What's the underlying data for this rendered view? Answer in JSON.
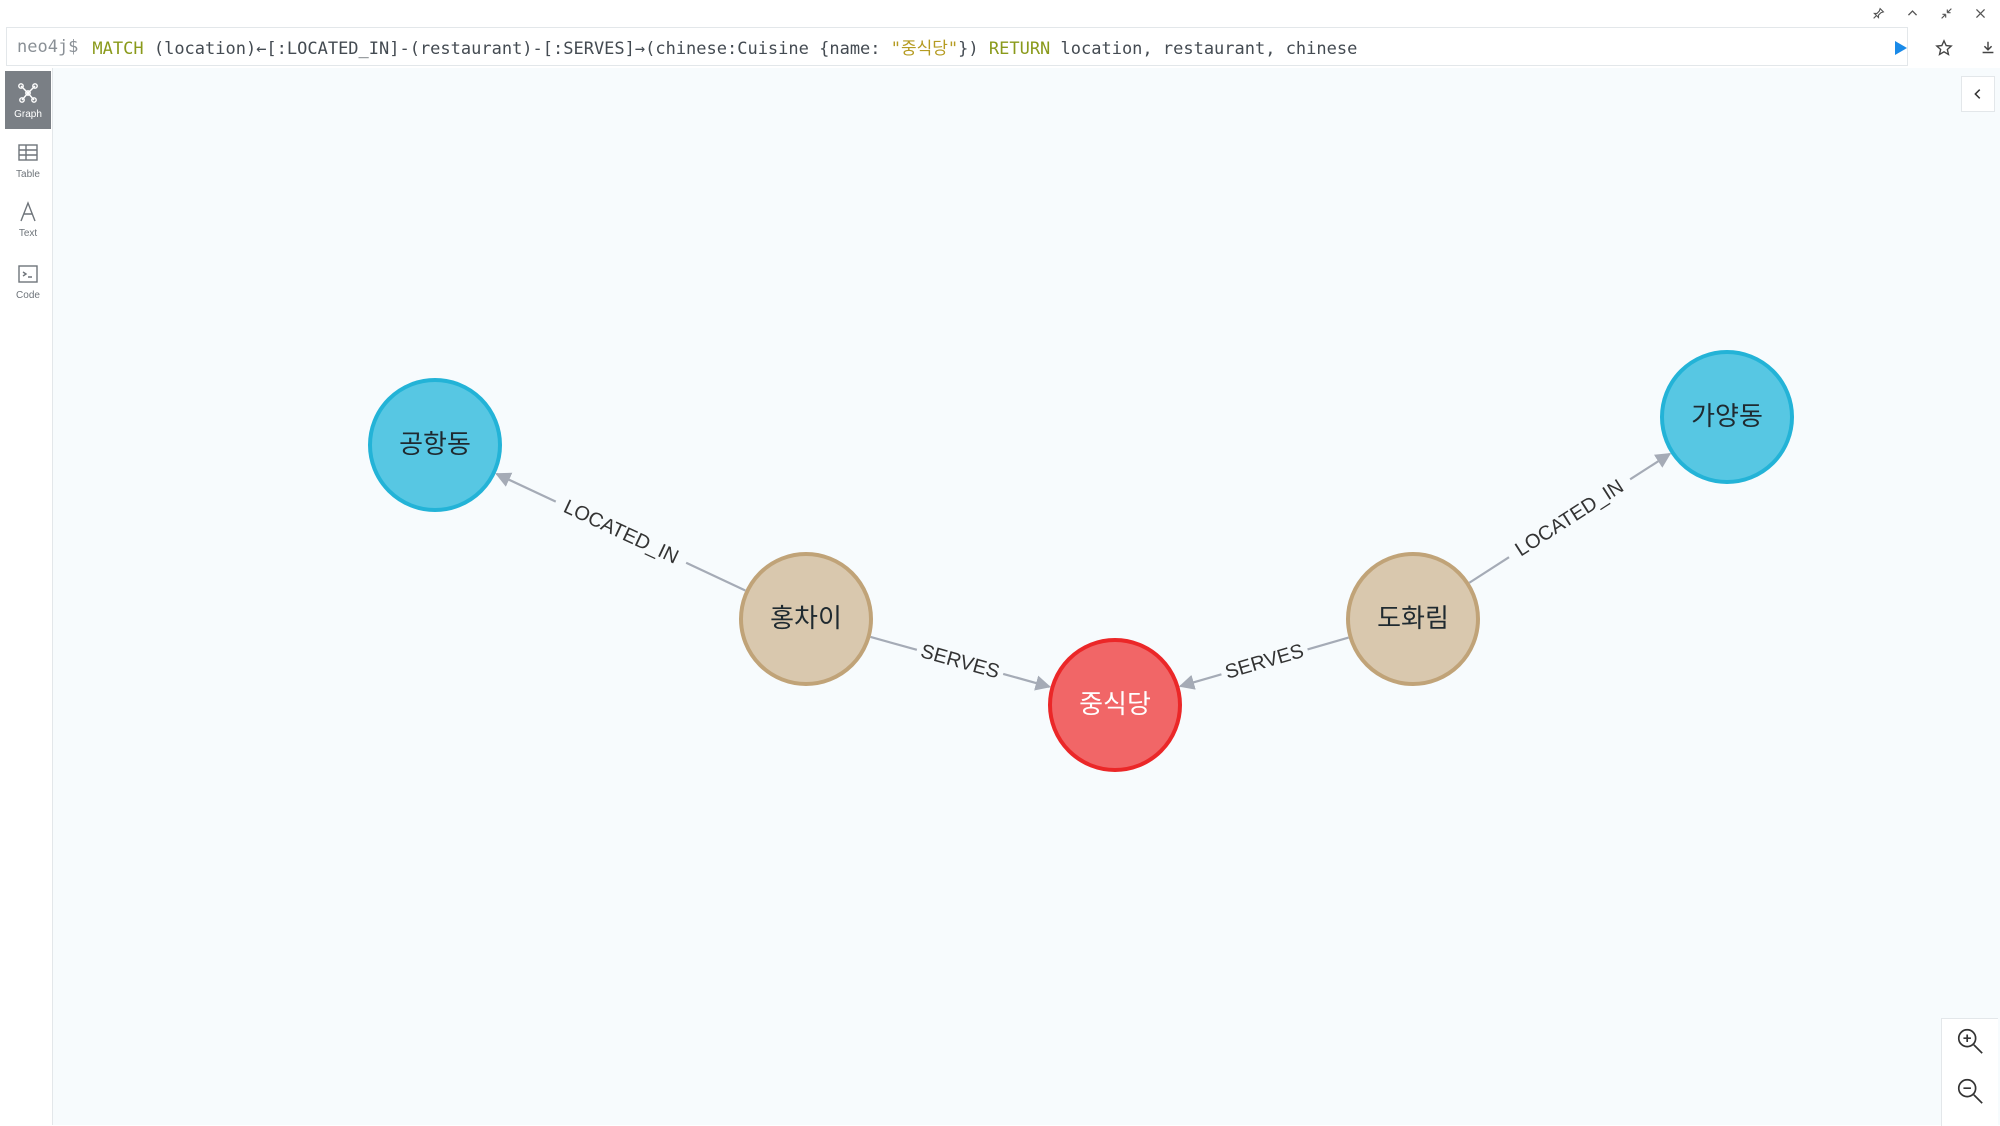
{
  "window": {
    "controls": [
      "pin-icon",
      "chevron-up-icon",
      "shrink-icon",
      "close-icon"
    ]
  },
  "query": {
    "prompt": "neo4j$",
    "parts": [
      {
        "text": "MATCH",
        "kind": "keyword"
      },
      {
        "text": " (location)←[:LOCATED_IN]-(restaurant)-[:SERVES]→(chinese:Cuisine {name: ",
        "kind": "plain"
      },
      {
        "text": "\"중식당\"",
        "kind": "string"
      },
      {
        "text": "}) ",
        "kind": "plain"
      },
      {
        "text": "RETURN",
        "kind": "keyword"
      },
      {
        "text": " location, restaurant, chinese",
        "kind": "plain"
      }
    ],
    "actions": [
      "play-icon",
      "star-icon",
      "download-icon"
    ]
  },
  "sidebar": {
    "items": [
      {
        "label": "Graph",
        "icon": "graph-icon",
        "active": true
      },
      {
        "label": "Table",
        "icon": "table-icon",
        "active": false
      },
      {
        "label": "Text",
        "icon": "text-icon",
        "active": false
      },
      {
        "label": "Code",
        "icon": "code-icon",
        "active": false
      }
    ]
  },
  "graph": {
    "colors": {
      "location_fill": "#57c7e3",
      "location_stroke": "#23b3d7",
      "restaurant_fill": "#d9c8ae",
      "restaurant_stroke": "#c0a378",
      "cuisine_fill": "#f16667",
      "cuisine_stroke": "#eb2728",
      "edge": "#a5abb6"
    },
    "nodes": [
      {
        "id": "n1",
        "label": "공항동",
        "type": "location"
      },
      {
        "id": "n2",
        "label": "가양동",
        "type": "location"
      },
      {
        "id": "n3",
        "label": "홍차이",
        "type": "restaurant"
      },
      {
        "id": "n4",
        "label": "도화림",
        "type": "restaurant"
      },
      {
        "id": "n5",
        "label": "중식당",
        "type": "cuisine"
      }
    ],
    "relationships": [
      {
        "from": "n3",
        "to": "n1",
        "label": "LOCATED_IN"
      },
      {
        "from": "n4",
        "to": "n2",
        "label": "LOCATED_IN"
      },
      {
        "from": "n3",
        "to": "n5",
        "label": "SERVES"
      },
      {
        "from": "n4",
        "to": "n5",
        "label": "SERVES"
      }
    ]
  },
  "controls": {
    "collapse": "chevron-left-icon",
    "zoom": [
      "zoom-in-icon",
      "zoom-out-icon"
    ]
  }
}
